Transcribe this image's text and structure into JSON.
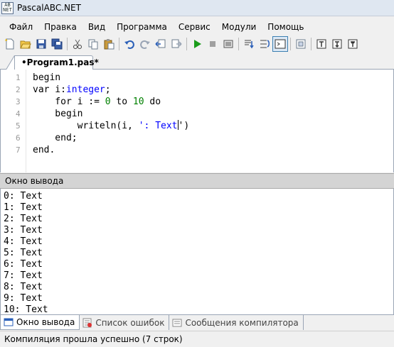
{
  "window": {
    "title": "PascalABC.NET",
    "icon_text": [
      "AB",
      "NET"
    ]
  },
  "menu": [
    "Файл",
    "Правка",
    "Вид",
    "Программа",
    "Сервис",
    "Модули",
    "Помощь"
  ],
  "toolbar_icons": [
    "new-file-icon",
    "open-folder-icon",
    "save-icon",
    "save-all-icon",
    "cut-icon",
    "copy-icon",
    "paste-icon",
    "undo-icon",
    "redo-icon",
    "navigate-back-icon",
    "navigate-forward-icon",
    "run-icon",
    "stop-icon",
    "compile-icon",
    "debug-step-into-icon",
    "debug-step-over-icon",
    "output-window-icon",
    "form-designer-icon",
    "step-icon-1",
    "step-icon-2",
    "step-icon-3"
  ],
  "editor": {
    "tab_label": "•Program1.pas*",
    "line_numbers": [
      "1",
      "2",
      "3",
      "4",
      "5",
      "6",
      "7"
    ],
    "lines": {
      "l1": "begin",
      "l2_kw": "var i:",
      "l2_type": "integer",
      "l2_end": ";",
      "l3_a": "    for i := ",
      "l3_n1": "0",
      "l3_b": " to ",
      "l3_n2": "10",
      "l3_c": " do",
      "l4": "    begin",
      "l5_a": "        writeln(i, ",
      "l5_str": "': Text",
      "l5_end": "')",
      "l6": "    end;",
      "l7": "end."
    }
  },
  "output_panel": {
    "header": "Окно вывода",
    "lines": [
      "0: Text",
      "1: Text",
      "2: Text",
      "3: Text",
      "4: Text",
      "5: Text",
      "6: Text",
      "7: Text",
      "8: Text",
      "9: Text",
      "10: Text"
    ]
  },
  "bottom_tabs": [
    {
      "label": "Окно вывода",
      "icon": "output-window-icon"
    },
    {
      "label": "Список ошибок",
      "icon": "error-list-icon"
    },
    {
      "label": "Сообщения компилятора",
      "icon": "compiler-messages-icon"
    }
  ],
  "status": "Компиляция прошла успешно (7 строк)",
  "colors": {
    "keyword_type": "#0000ff",
    "number": "#008000",
    "string": "#0000ff",
    "run_green": "#1a9c1a",
    "active_border": "#3c7fb1"
  }
}
